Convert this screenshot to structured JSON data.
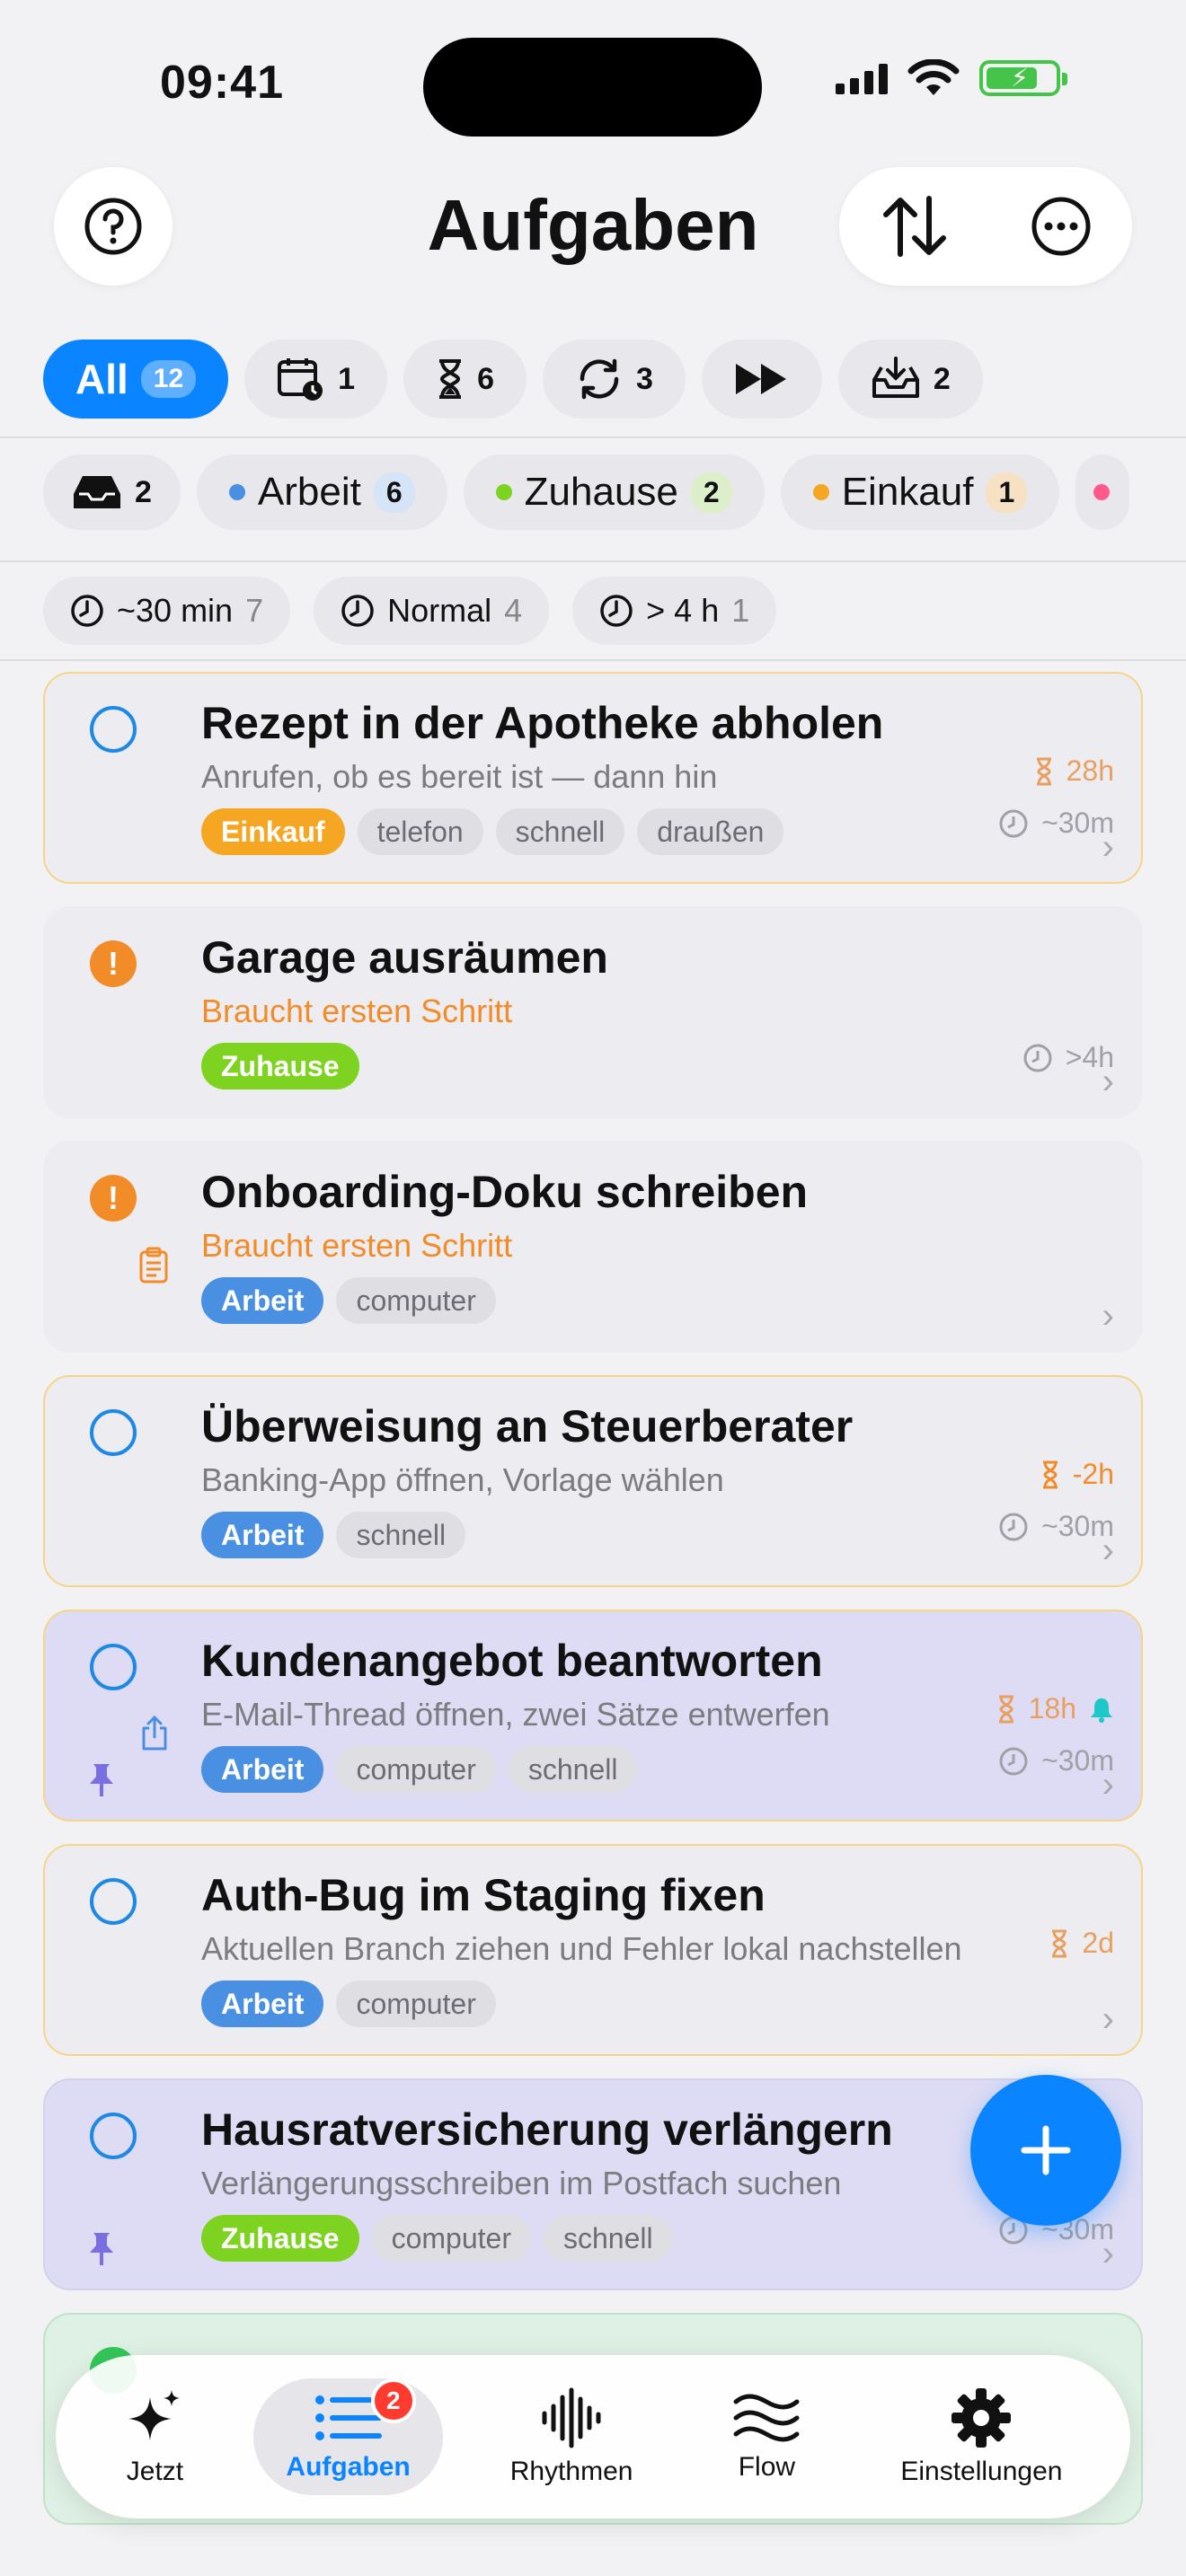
{
  "status": {
    "time": "09:41"
  },
  "header": {
    "title": "Aufgaben"
  },
  "filters": {
    "all_label": "All",
    "all_count": "12",
    "scheduled_count": "1",
    "deadline_count": "6",
    "recurring_count": "3",
    "inbox_count": "2"
  },
  "categories": [
    {
      "label": "",
      "count": "2"
    },
    {
      "label": "Arbeit",
      "count": "6",
      "color": "#4a90e2",
      "badge_bg": "#d6e4f7"
    },
    {
      "label": "Zuhause",
      "count": "2",
      "color": "#7ed321",
      "badge_bg": "#dcefc8"
    },
    {
      "label": "Einkauf",
      "count": "1",
      "color": "#f5a623",
      "badge_bg": "#f6e1c4"
    }
  ],
  "durations": [
    {
      "label": "~30 min",
      "count": "7"
    },
    {
      "label": "Normal",
      "count": "4"
    },
    {
      "label": "> 4 h",
      "count": "1"
    }
  ],
  "tasks": [
    {
      "title": "Rezept in der Apotheke abholen",
      "subtitle": "Anrufen, ob es bereit ist — dann hin",
      "category": "Einkauf",
      "tags": [
        "telefon",
        "schnell",
        "draußen"
      ],
      "deadline": "28h",
      "duration": "~30m"
    },
    {
      "title": "Garage ausräumen",
      "subtitle": "Braucht ersten Schritt",
      "category": "Zuhause",
      "tags": [],
      "duration": ">4h"
    },
    {
      "title": "Onboarding-Doku schreiben",
      "subtitle": "Braucht ersten Schritt",
      "category": "Arbeit",
      "tags": [
        "computer"
      ]
    },
    {
      "title": "Überweisung an Steuerberater",
      "subtitle": "Banking-App öffnen, Vorlage wählen",
      "category": "Arbeit",
      "tags": [
        "schnell"
      ],
      "deadline": "-2h",
      "duration": "~30m"
    },
    {
      "title": "Kundenangebot beantworten",
      "subtitle": "E-Mail-Thread öffnen, zwei Sätze entwerfen",
      "category": "Arbeit",
      "tags": [
        "computer",
        "schnell"
      ],
      "deadline": "18h",
      "duration": "~30m"
    },
    {
      "title": "Auth-Bug im Staging fixen",
      "subtitle": "Aktuellen Branch ziehen und Fehler lokal nachstellen",
      "category": "Arbeit",
      "tags": [
        "computer"
      ],
      "deadline": "2d"
    },
    {
      "title": "Hausratversicherung verlängern",
      "subtitle": "Verlängerungsschreiben im Postfach suchen",
      "category": "Zuhause",
      "tags": [
        "computer",
        "schnell"
      ],
      "duration": "~30m"
    }
  ],
  "tabbar": {
    "items": [
      {
        "label": "Jetzt"
      },
      {
        "label": "Aufgaben",
        "badge": "2"
      },
      {
        "label": "Rhythmen"
      },
      {
        "label": "Flow"
      },
      {
        "label": "Einstellungen"
      }
    ]
  },
  "colors": {
    "accent": "#0a84ff",
    "arbeit": "#4a90e2",
    "zuhause": "#7ed321",
    "einkauf": "#f5a623",
    "warning": "#f28c28"
  }
}
